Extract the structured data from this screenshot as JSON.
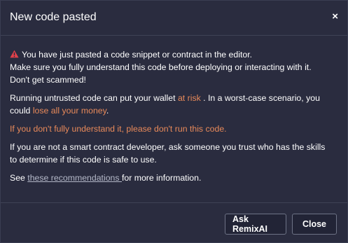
{
  "modal": {
    "title": "New code pasted",
    "close_symbol": "×"
  },
  "body": {
    "warning_icon": "warning-triangle-icon",
    "warning_line1": "You have just pasted a code snippet or contract in the editor.",
    "warning_line2": "Make sure you fully understand this code before deploying or interacting with it.",
    "warning_line3": "Don't get scammed!",
    "risk_prefix": "Running untrusted code can put your wallet ",
    "risk_link": "at risk",
    "risk_middle": " . In a worst-case scenario, you",
    "risk_line2_prefix": "could ",
    "risk_line2_danger": "lose all your money",
    "risk_line2_suffix": ".",
    "dont_run": "If you don't fully understand it, please don't run this code.",
    "advice_line1": "If you are not a smart contract developer, ask someone you trust who has the skills",
    "advice_line2": "to determine if this code is safe to use.",
    "see_prefix": "See ",
    "see_link": "these recommendations ",
    "see_suffix": "for more information."
  },
  "footer": {
    "ask_label": "Ask RemixAI",
    "close_label": "Close"
  },
  "colors": {
    "background": "#2a2c3f",
    "danger": "#e98a5a",
    "warning_icon": "#e0404a",
    "link": "#b5b9c9"
  }
}
